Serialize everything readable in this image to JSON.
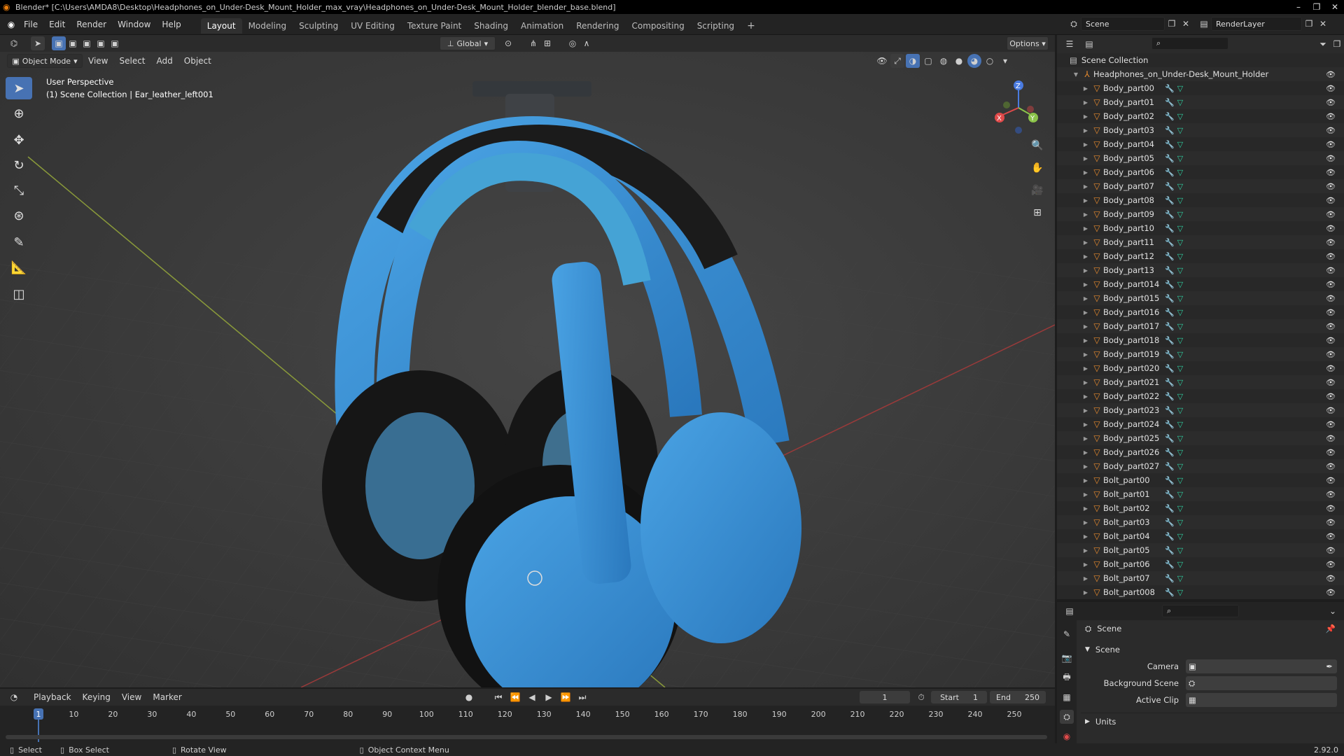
{
  "window": {
    "title": "Blender* [C:\\Users\\AMDA8\\Desktop\\Headphones_on_Under-Desk_Mount_Holder_max_vray\\Headphones_on_Under-Desk_Mount_Holder_blender_base.blend]"
  },
  "menu": [
    "File",
    "Edit",
    "Render",
    "Window",
    "Help"
  ],
  "workspaces": [
    "Layout",
    "Modeling",
    "Sculpting",
    "UV Editing",
    "Texture Paint",
    "Shading",
    "Animation",
    "Rendering",
    "Compositing",
    "Scripting"
  ],
  "scene": {
    "name": "Scene",
    "layer": "RenderLayer"
  },
  "viewport": {
    "transform": "Global",
    "options": "Options",
    "mode": "Object Mode",
    "menus": [
      "View",
      "Select",
      "Add",
      "Object"
    ],
    "perspective": "User Perspective",
    "context": "(1) Scene Collection | Ear_leather_left001",
    "axes": {
      "x": "X",
      "y": "Y",
      "z": "Z"
    }
  },
  "outliner": {
    "root": "Scene Collection",
    "collection": "Headphones_on_Under-Desk_Mount_Holder",
    "items": [
      "Body_part00",
      "Body_part01",
      "Body_part02",
      "Body_part03",
      "Body_part04",
      "Body_part05",
      "Body_part06",
      "Body_part07",
      "Body_part08",
      "Body_part09",
      "Body_part10",
      "Body_part11",
      "Body_part12",
      "Body_part13",
      "Body_part014",
      "Body_part015",
      "Body_part016",
      "Body_part017",
      "Body_part018",
      "Body_part019",
      "Body_part020",
      "Body_part021",
      "Body_part022",
      "Body_part023",
      "Body_part024",
      "Body_part025",
      "Body_part026",
      "Body_part027",
      "Bolt_part00",
      "Bolt_part01",
      "Bolt_part02",
      "Bolt_part03",
      "Bolt_part04",
      "Bolt_part05",
      "Bolt_part06",
      "Bolt_part07",
      "Bolt_part008"
    ]
  },
  "properties": {
    "header": "Scene",
    "section": "Scene",
    "fields": [
      {
        "label": "Camera"
      },
      {
        "label": "Background Scene"
      },
      {
        "label": "Active Clip"
      }
    ],
    "units": "Units"
  },
  "timeline": {
    "menus": [
      "Playback",
      "Keying",
      "View",
      "Marker"
    ],
    "current_frame": "1",
    "start_label": "Start",
    "start": "1",
    "end_label": "End",
    "end": "250",
    "ticks": [
      "1",
      "10",
      "20",
      "30",
      "40",
      "50",
      "60",
      "70",
      "80",
      "90",
      "100",
      "110",
      "120",
      "130",
      "140",
      "150",
      "160",
      "170",
      "180",
      "190",
      "200",
      "210",
      "220",
      "230",
      "240",
      "250"
    ]
  },
  "status": {
    "select": "Select",
    "box_select": "Box Select",
    "rotate": "Rotate View",
    "context_menu": "Object Context Menu",
    "version": "2.92.0"
  },
  "colors": {
    "accent": "#4772b3",
    "headphone": "#3a8fd0",
    "object_icon": "#e88b2e",
    "mesh_icon": "#2fcfa0"
  }
}
